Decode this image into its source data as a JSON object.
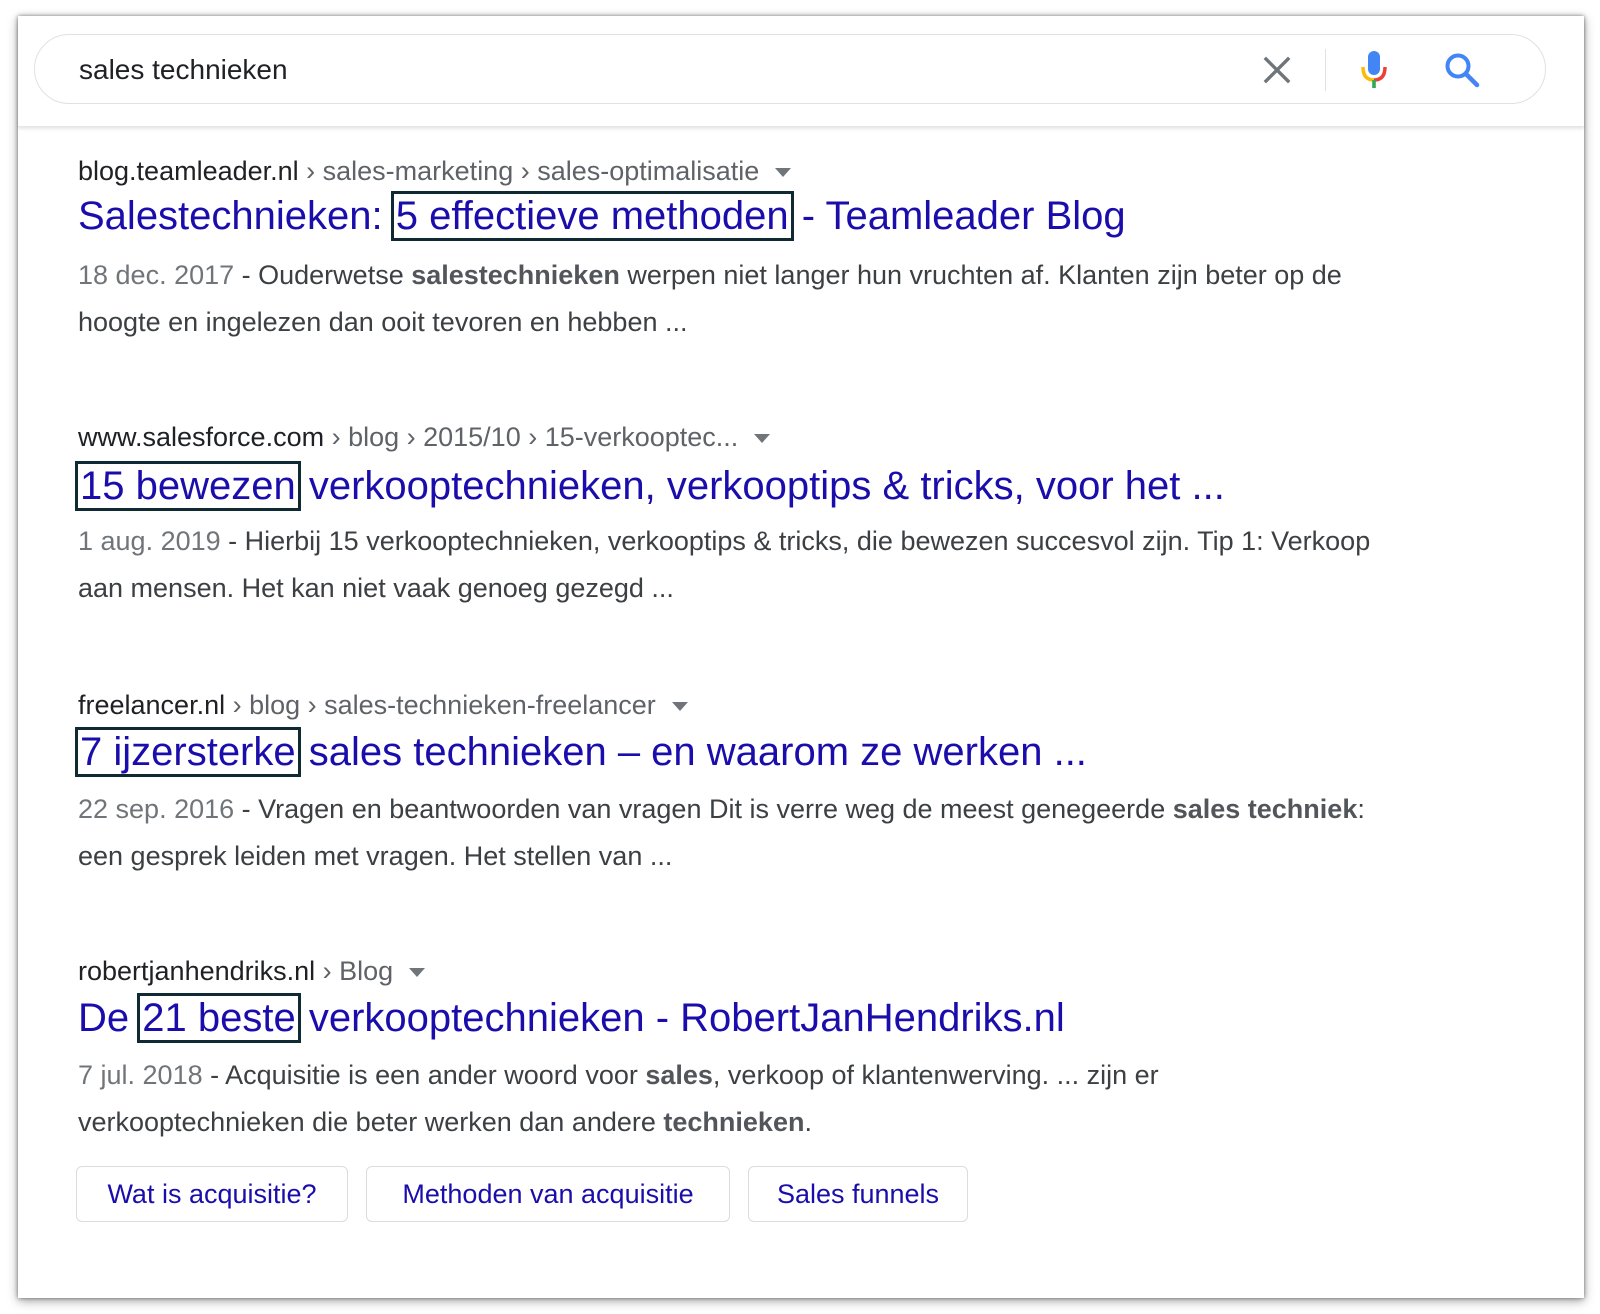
{
  "search": {
    "query": "sales technieken"
  },
  "results": [
    {
      "domain": "blog.teamleader.nl",
      "path": " › sales-marketing › sales-optimalisatie",
      "title_pre": "Salestechnieken: ",
      "title_hl": "5 effectieve methoden",
      "title_post": " - Teamleader Blog",
      "date": "18 dec. 2017",
      "snippet_a": " - Ouderwetse ",
      "snippet_b": "salestechnieken",
      "snippet_c": " werpen niet langer hun vruchten af. Klanten zijn beter op de hoogte en ingelezen dan ooit tevoren en hebben ..."
    },
    {
      "domain": "www.salesforce.com",
      "path": " › blog › 2015/10 › 15-verkooptec...",
      "title_pre": "",
      "title_hl": "15 bewezen",
      "title_post": " verkooptechnieken, verkooptips & tricks, voor het ...",
      "date": "1 aug. 2019",
      "snippet_a": " - Hierbij 15 verkooptechnieken, verkooptips & tricks, die bewezen succesvol zijn. Tip 1: Verkoop aan mensen. Het kan niet vaak genoeg gezegd ..."
    },
    {
      "domain": "freelancer.nl",
      "path": " › blog › sales-technieken-freelancer",
      "title_pre": "",
      "title_hl": "7 ijzersterke",
      "title_post": " sales technieken – en waarom ze werken ...",
      "date": "22 sep. 2016",
      "snippet_a": " - Vragen en beantwoorden van vragen Dit is verre weg de meest genegeerde ",
      "snippet_b": "sales techniek",
      "snippet_c": ": een gesprek leiden met vragen. Het stellen van ..."
    },
    {
      "domain": "robertjanhendriks.nl",
      "path": " › Blog",
      "title_pre": "De ",
      "title_hl": "21 beste",
      "title_post": " verkooptechnieken - RobertJanHendriks.nl",
      "date": "7 jul. 2018",
      "snippet_a": " - Acquisitie is een ander woord voor ",
      "snippet_b": "sales",
      "snippet_c": ", verkoop of klantenwerving. ... zijn er verkooptechnieken die beter werken dan andere ",
      "snippet_d": "technieken",
      "snippet_e": "."
    }
  ],
  "sitelinks": [
    "Wat is acquisitie?",
    "Methoden van acquisitie",
    "Sales funnels"
  ],
  "icons": {
    "clear": "close-icon",
    "mic": "microphone-icon",
    "search": "search-icon",
    "dropdown": "dropdown-arrow-icon"
  },
  "colors": {
    "link": "#1a0dab",
    "highlight_box": "#0f2a33",
    "text": "#202124",
    "date": "#70757a"
  }
}
